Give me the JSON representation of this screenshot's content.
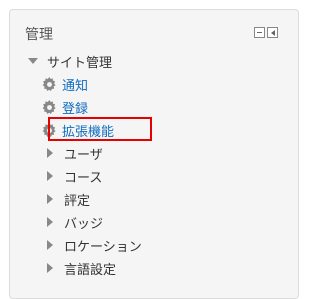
{
  "block": {
    "title": "管理",
    "controls": {
      "hide_icon": "minus-square-icon",
      "dock_icon": "dock-left-icon"
    }
  },
  "tree": {
    "root": {
      "label": "サイト管理",
      "expanded": true
    },
    "settings_items": [
      {
        "label": "通知",
        "icon": "gear-icon"
      },
      {
        "label": "登録",
        "icon": "gear-icon"
      },
      {
        "label": "拡張機能",
        "icon": "gear-icon",
        "highlighted": true
      }
    ],
    "collapsed_items": [
      {
        "label": "ユーザ"
      },
      {
        "label": "コース"
      },
      {
        "label": "評定"
      },
      {
        "label": "バッジ"
      },
      {
        "label": "ロケーション"
      },
      {
        "label": "言語設定"
      }
    ]
  },
  "colors": {
    "link": "#0f6cbf",
    "highlight": "#e60000",
    "block_bg": "#f5f5f5"
  }
}
